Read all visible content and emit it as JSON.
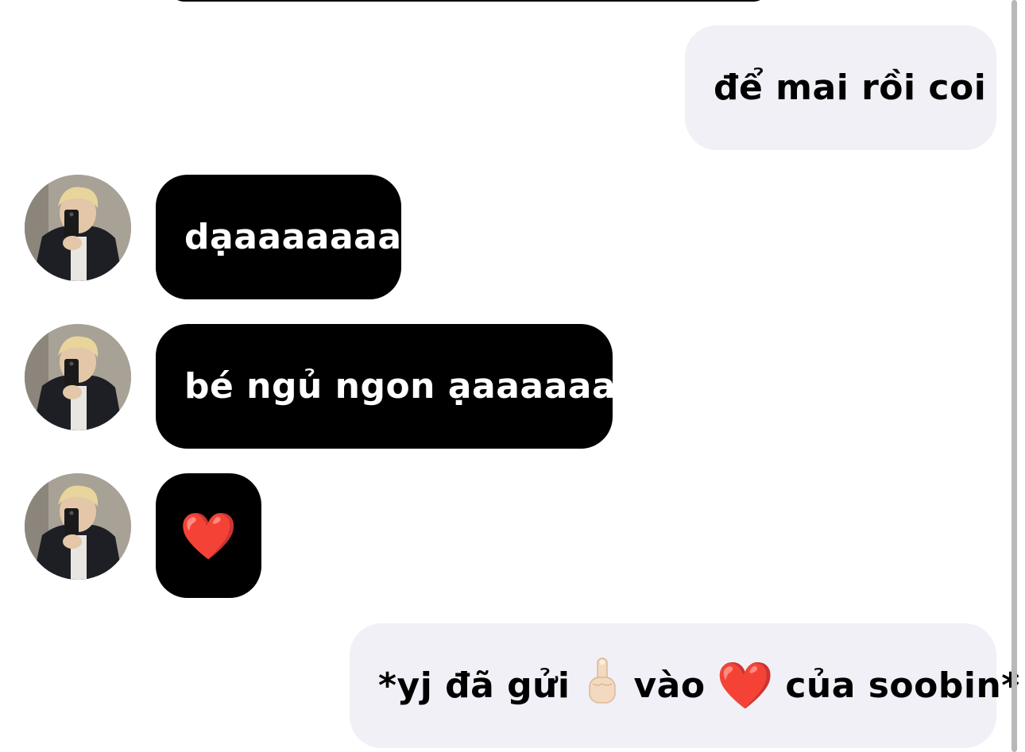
{
  "messages": [
    {
      "direction": "out",
      "text": "để mai rồi coi"
    },
    {
      "direction": "in",
      "text": "dạaaaaaaa"
    },
    {
      "direction": "in",
      "text": "bé ngủ ngon ạaaaaaaa"
    },
    {
      "direction": "in",
      "text": "❤️"
    },
    {
      "direction": "out",
      "text_before": "*yj đã gửi",
      "finger_icon": "middle-finger-emoji",
      "text_middle": "vào",
      "heart_icon": "❤️",
      "text_after": "của soobin*"
    }
  ],
  "colors": {
    "outgoing_bubble": "#f0f0f6",
    "incoming_bubble": "#000000",
    "heart": "#e0101e",
    "scrollbar": "#b8b8b8"
  }
}
